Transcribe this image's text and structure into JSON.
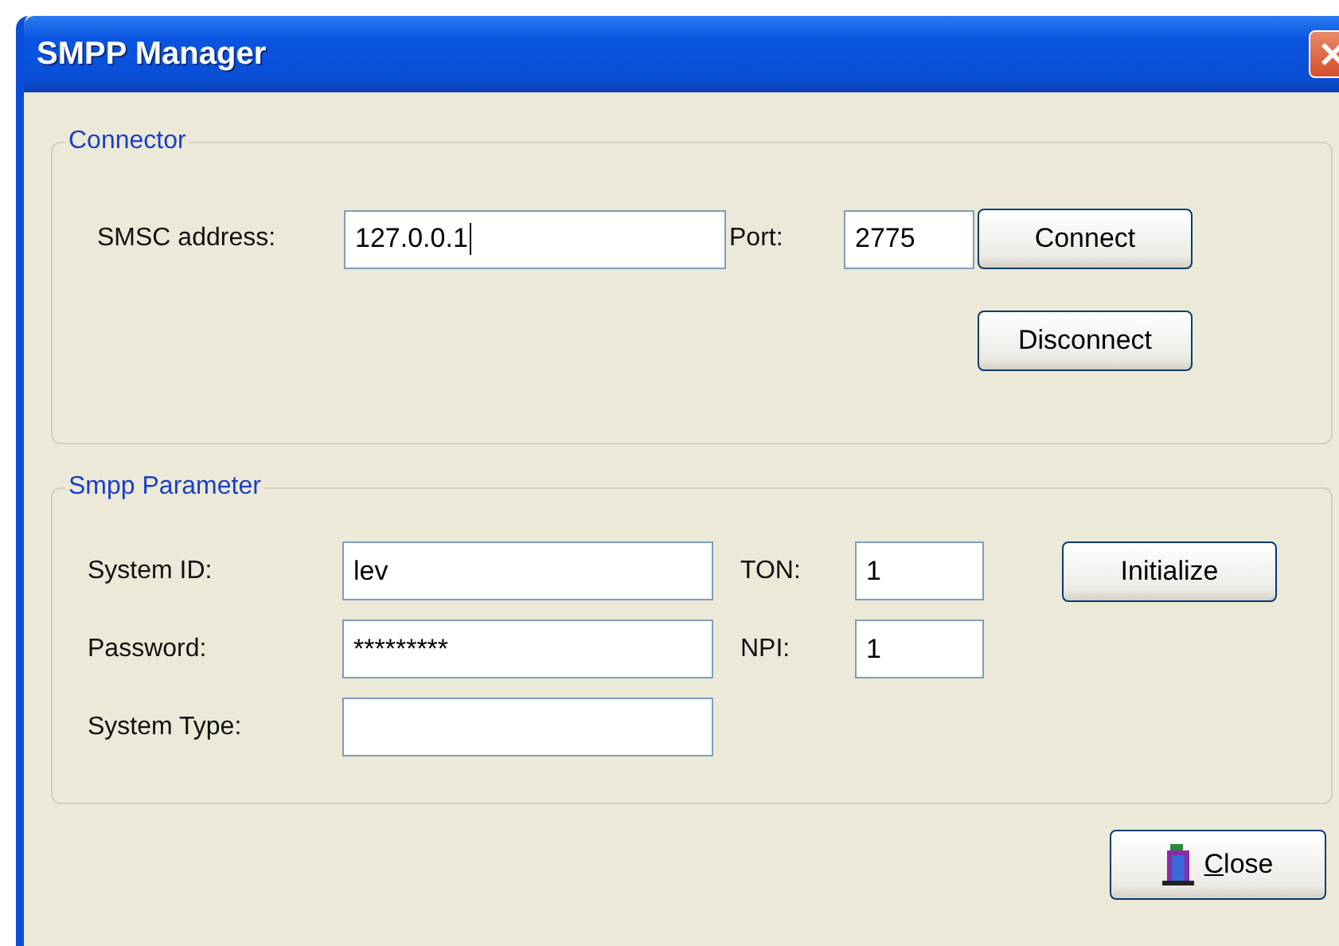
{
  "window": {
    "title": "SMPP Manager"
  },
  "connector": {
    "title": "Connector",
    "address_label": "SMSC address:",
    "address": "127.0.0.1",
    "address_focused": true,
    "port_label": "Port:",
    "port": "2775",
    "buttons": [
      "Connect",
      "Disconnect"
    ]
  },
  "parameters": {
    "title": "Smpp Parameter",
    "fields": [
      {
        "label": "System ID:",
        "value": "lev"
      },
      {
        "label": "Password:",
        "value": "*********"
      },
      {
        "label": "System Type:"
      }
    ],
    "small_fields": [
      {
        "label": "TON:",
        "value": "1"
      },
      {
        "label": "NPI:",
        "value": "1"
      }
    ],
    "button": "Initialize"
  },
  "close_button": {
    "label": "Close"
  }
}
